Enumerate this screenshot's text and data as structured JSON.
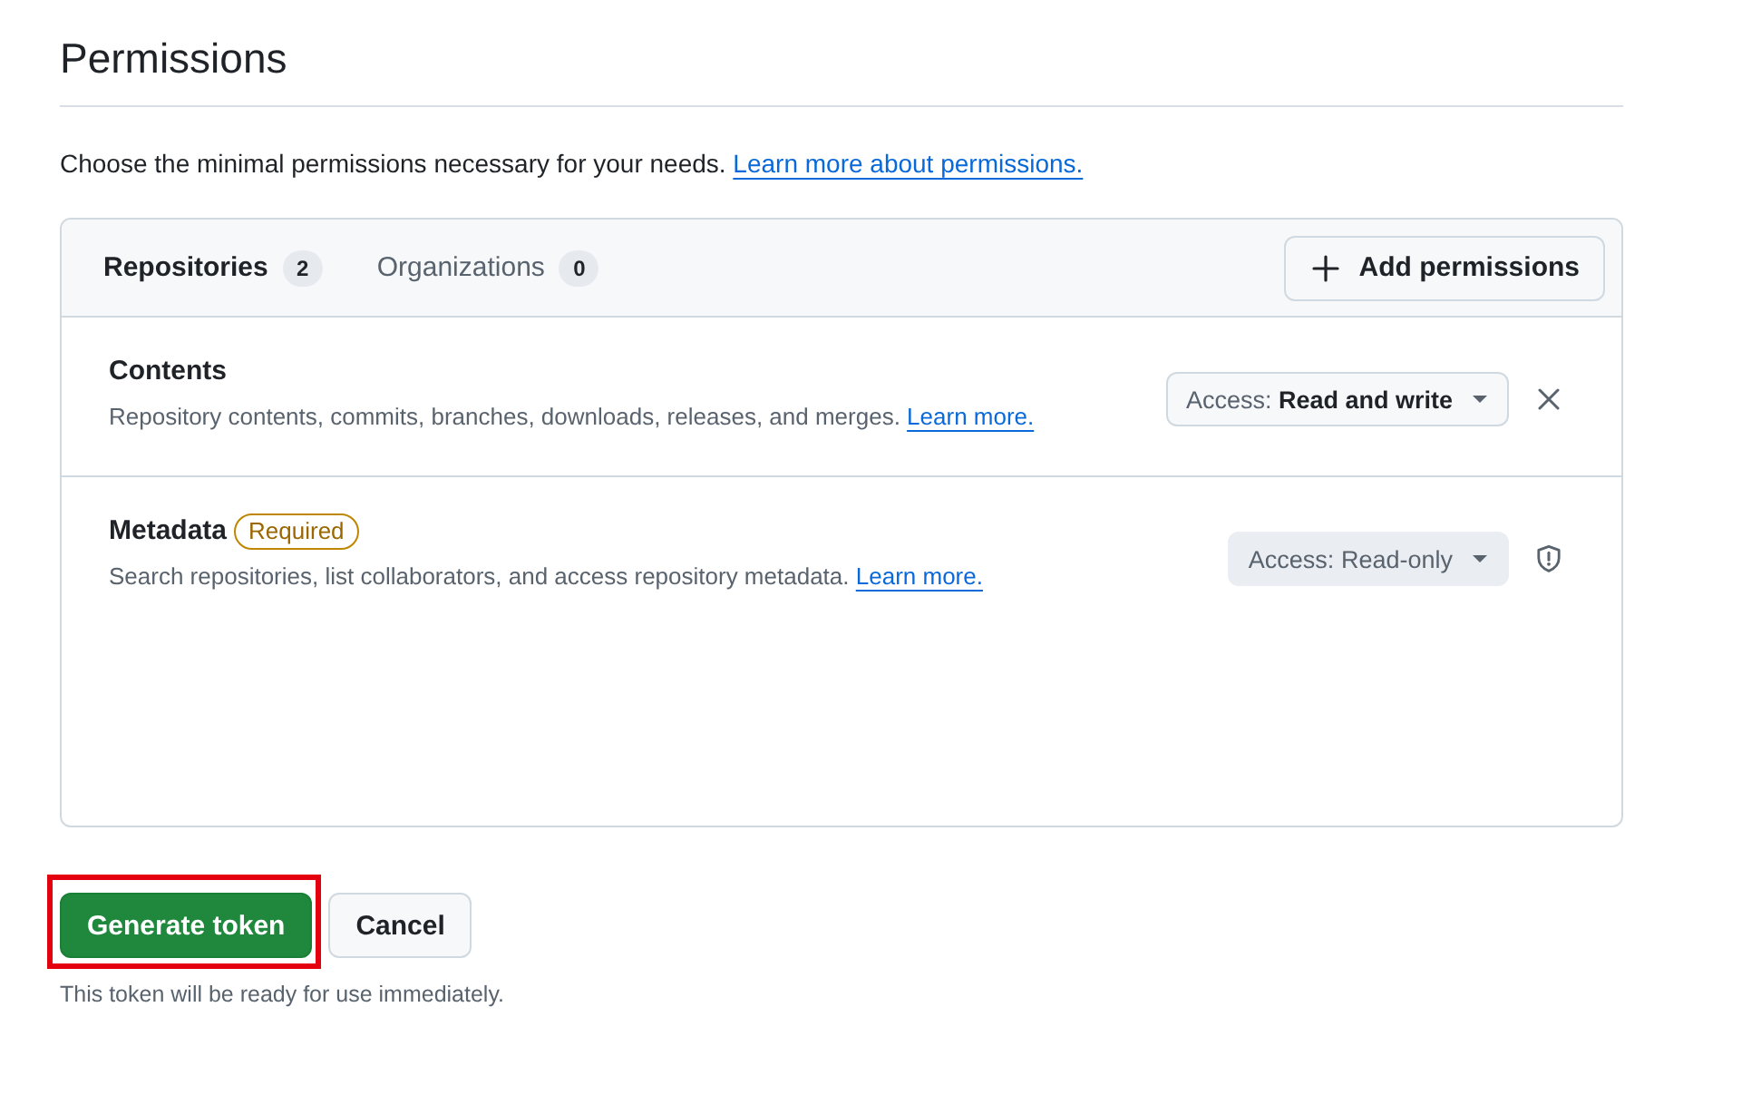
{
  "section": {
    "title": "Permissions"
  },
  "intro": {
    "text": "Choose the minimal permissions necessary for your needs.",
    "link": "Learn more about permissions."
  },
  "permissions_panel": {
    "tabs": [
      {
        "label": "Repositories",
        "count": "2",
        "selected": true
      },
      {
        "label": "Organizations",
        "count": "0",
        "selected": false
      }
    ],
    "add_button": {
      "label": "Add permissions"
    },
    "rows": [
      {
        "name": "Contents",
        "description": "Repository contents, commits, branches, downloads, releases, and merges.",
        "link": "Learn more.",
        "access_label": "Access:",
        "access_value": "Read and write",
        "disabled": false,
        "required": false
      },
      {
        "name": "Metadata",
        "badge": "Required",
        "description": "Search repositories, list collaborators, and access repository metadata.",
        "link": "Learn more.",
        "access_label": "Access:",
        "access_value": "Read-only",
        "disabled": true,
        "required": true
      }
    ]
  },
  "actions": {
    "buttons": [
      {
        "label": "Generate token",
        "kind": "primary",
        "highlighted": true
      },
      {
        "label": "Cancel",
        "kind": "secondary",
        "highlighted": false
      }
    ],
    "note": "This token will be ready for use immediately."
  }
}
